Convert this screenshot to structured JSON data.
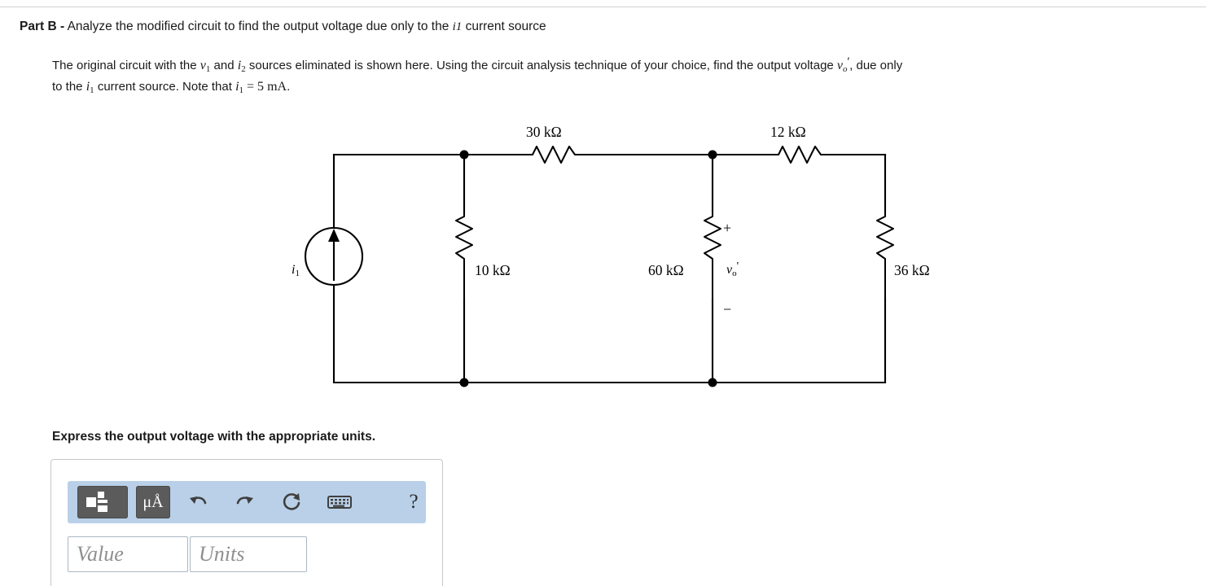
{
  "part": {
    "label": "Part B -",
    "title": "Analyze the modified circuit to find the output voltage due only to the i1 current source",
    "title_pre": "Analyze the modified circuit to find the output voltage due only to the ",
    "title_i1": "i1",
    "title_post": " current source"
  },
  "prompt": {
    "s1": "The original circuit with the ",
    "v1": "v",
    "v1_sub": "1",
    "s2": " and ",
    "i2": "i",
    "i2_sub": "2",
    "s3": " sources eliminated is shown here. Using the circuit analysis technique of your choice, find the output voltage ",
    "vo": "v",
    "vo_sub": "o",
    "vo_prime": "′",
    "s4": ", due only",
    "s5": "to the ",
    "i1": "i",
    "i1_sub": "1",
    "s6": " current source. Note that ",
    "i1b": "i",
    "i1b_sub": "1",
    "s7": " = 5 ",
    "unit": "mA",
    "s8": "."
  },
  "circuit": {
    "source_label": "i",
    "source_sub": "1",
    "r_top_left": "30 kΩ",
    "r_top_right": "12 kΩ",
    "r_left": "10 kΩ",
    "r_mid": "60 kΩ",
    "r_right": "36 kΩ",
    "plus": "+",
    "minus": "−",
    "vo": "v",
    "vo_sub": "o",
    "vo_prime": "'"
  },
  "express": "Express the output voltage with the appropriate units.",
  "toolbar": {
    "template_icon": "math-template-icon",
    "units_label": "μÅ",
    "units_mu": "μ",
    "units_A": "A",
    "undo_icon": "undo-icon",
    "redo_icon": "redo-icon",
    "reset_icon": "reset-icon",
    "keyboard_icon": "keyboard-icon",
    "help_label": "?"
  },
  "answer": {
    "value_placeholder": "Value",
    "units_placeholder": "Units"
  },
  "colors": {
    "toolbar_bg": "#b9d0e8",
    "button_bg": "#5b5b5b",
    "field_border": "#aab7c4",
    "panel_border": "#c8c8c8"
  }
}
